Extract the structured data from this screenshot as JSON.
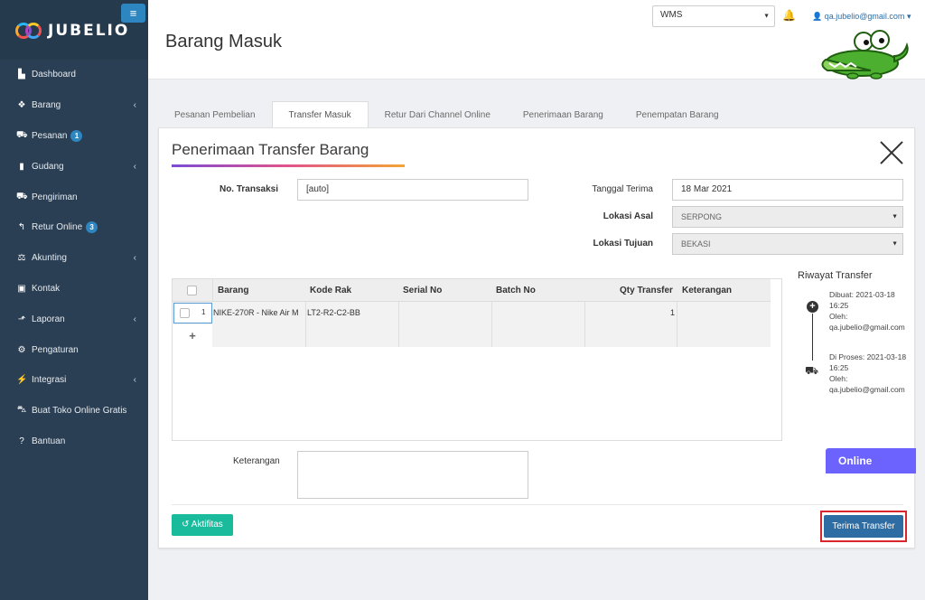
{
  "brand": {
    "name": "JUBELIO"
  },
  "sidebar": {
    "items": [
      {
        "label": "Dashboard",
        "icon": "chart-icon",
        "glyph": "▙",
        "badge": "",
        "chevron": false
      },
      {
        "label": "Barang",
        "icon": "cubes-icon",
        "glyph": "❖",
        "badge": "",
        "chevron": true
      },
      {
        "label": "Pesanan",
        "icon": "basket-icon",
        "glyph": "⛟",
        "badge": "1",
        "chevron": false
      },
      {
        "label": "Gudang",
        "icon": "building-icon",
        "glyph": "▮",
        "badge": "",
        "chevron": true
      },
      {
        "label": "Pengiriman",
        "icon": "truck-icon",
        "glyph": "⛟",
        "badge": "",
        "chevron": false
      },
      {
        "label": "Retur Online",
        "icon": "reply-icon",
        "glyph": "↰",
        "badge": "3",
        "chevron": false
      },
      {
        "label": "Akunting",
        "icon": "balance-scale-icon",
        "glyph": "⚖",
        "badge": "",
        "chevron": true
      },
      {
        "label": "Kontak",
        "icon": "id-card-icon",
        "glyph": "▣",
        "badge": "",
        "chevron": false
      },
      {
        "label": "Laporan",
        "icon": "line-chart-icon",
        "glyph": "⬏",
        "badge": "",
        "chevron": true
      },
      {
        "label": "Pengaturan",
        "icon": "cogs-icon",
        "glyph": "⚙",
        "badge": "",
        "chevron": false
      },
      {
        "label": "Integrasi",
        "icon": "plug-icon",
        "glyph": "⚡",
        "badge": "",
        "chevron": true
      },
      {
        "label": "Buat Toko Online Gratis",
        "icon": "cart-icon",
        "glyph": "⛍",
        "badge": "",
        "chevron": false
      },
      {
        "label": "Bantuan",
        "icon": "question-circle-icon",
        "glyph": "?",
        "badge": "",
        "chevron": false
      }
    ]
  },
  "header": {
    "title": "Barang Masuk",
    "warehouse_select": "WMS",
    "user_email": "qa.jubelio@gmail.com"
  },
  "tabs": [
    "Pesanan Pembelian",
    "Transfer Masuk",
    "Retur Dari Channel Online",
    "Penerimaan Barang",
    "Penempatan Barang"
  ],
  "form": {
    "title": "Penerimaan Transfer Barang",
    "no_transaksi_label": "No. Transaksi",
    "no_transaksi_value": "[auto]",
    "tanggal_label": "Tanggal Terima",
    "tanggal_value": "18 Mar 2021",
    "lokasi_asal_label": "Lokasi Asal",
    "lokasi_asal_value": "SERPONG",
    "lokasi_tujuan_label": "Lokasi Tujuan",
    "lokasi_tujuan_value": "BEKASI",
    "keterangan_label": "Keterangan"
  },
  "grid": {
    "columns": [
      "Barang",
      "Kode Rak",
      "Serial No",
      "Batch No",
      "Qty Transfer",
      "Keterangan"
    ],
    "rows": [
      {
        "no": "1",
        "barang": "NIKE-270R - Nike Air M",
        "kode_rak": "LT2-R2-C2-BB",
        "serial_no": "",
        "batch_no": "",
        "qty": "1",
        "keterangan": ""
      }
    ],
    "add_symbol": "+"
  },
  "history": {
    "title": "Riwayat Transfer",
    "entries": [
      {
        "text": "Dibuat: 2021-03-18 16:25",
        "by_label": "Oleh:",
        "by": "qa.jubelio@gmail.com",
        "icon": "plus-circle-icon"
      },
      {
        "text": "Di Proses: 2021-03-18 16:25",
        "by_label": "Oleh:",
        "by": "qa.jubelio@gmail.com",
        "icon": "truck-icon"
      }
    ]
  },
  "chat": {
    "label": "Online"
  },
  "buttons": {
    "aktifitas": "Aktifitas",
    "terima": "Terima Transfer"
  }
}
